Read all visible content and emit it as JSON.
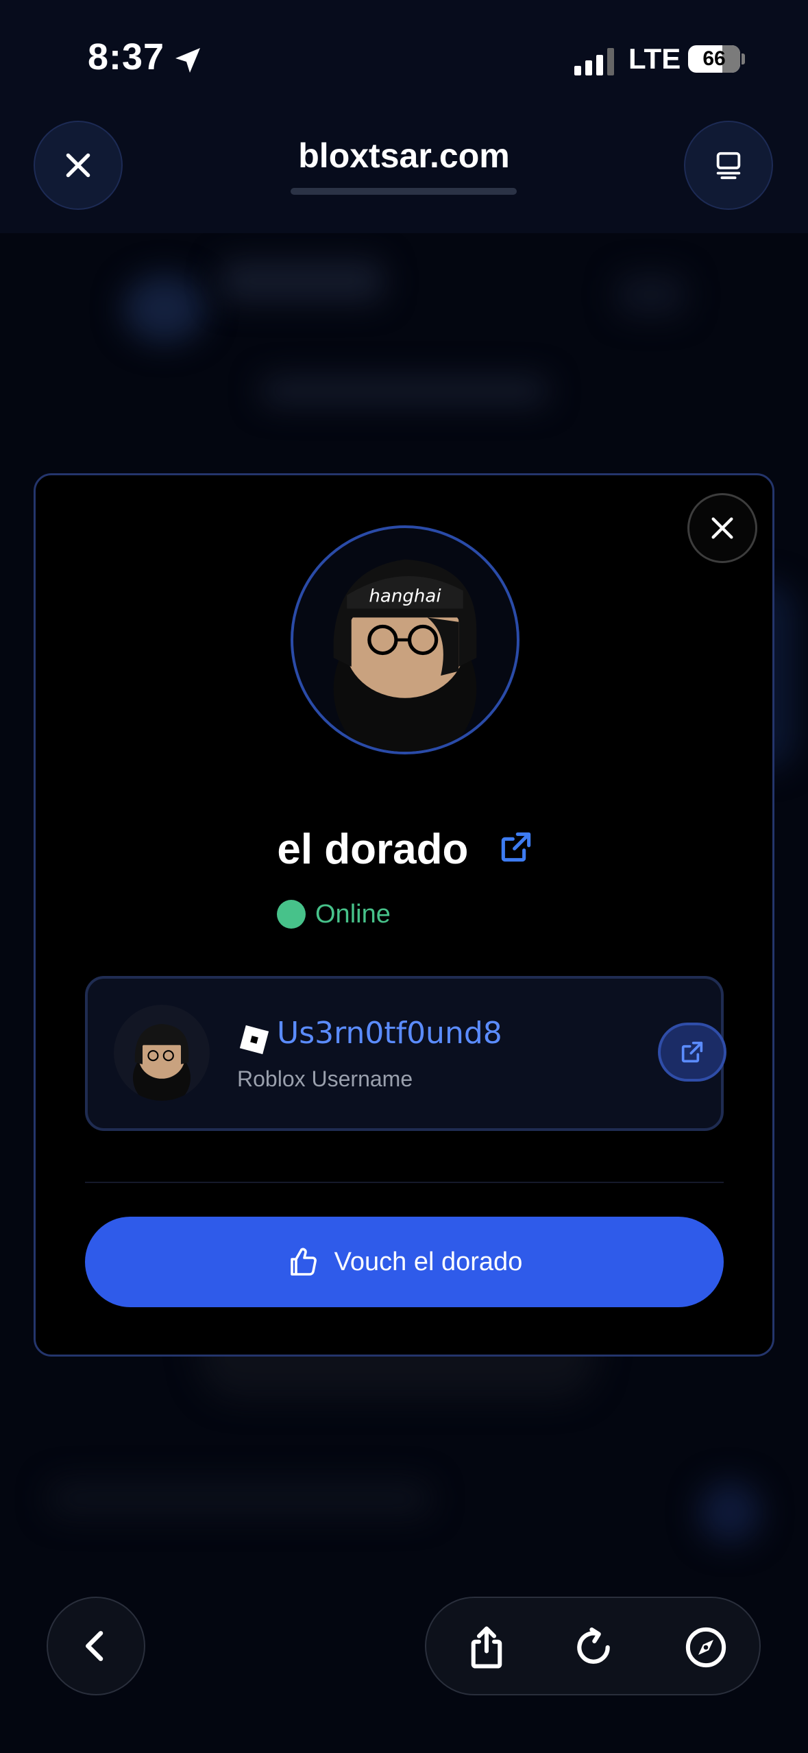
{
  "status_bar": {
    "time": "8:37",
    "network": "LTE",
    "battery": "66",
    "icons": [
      "location-arrow-icon",
      "cell-signal-icon",
      "battery-icon"
    ]
  },
  "browser": {
    "url": "bloxtsar.com",
    "top_icons": [
      "close-icon",
      "tabs-icon"
    ],
    "bottom_icons": [
      "back-icon",
      "share-icon",
      "reload-icon",
      "compass-icon"
    ]
  },
  "modal": {
    "profile_name": "el dorado",
    "status": "Online",
    "roblox_username": "Us3rn0tf0und8",
    "roblox_label": "Roblox Username",
    "vouch_button": "Vouch el dorado",
    "icons": [
      "close-icon",
      "external-link-icon",
      "roblox-logo-icon",
      "thumbs-up-icon"
    ]
  },
  "colors": {
    "accent_blue": "#2f5bea",
    "link_blue": "#5b8cff",
    "online_green": "#47c28a",
    "modal_border": "#24356c"
  }
}
